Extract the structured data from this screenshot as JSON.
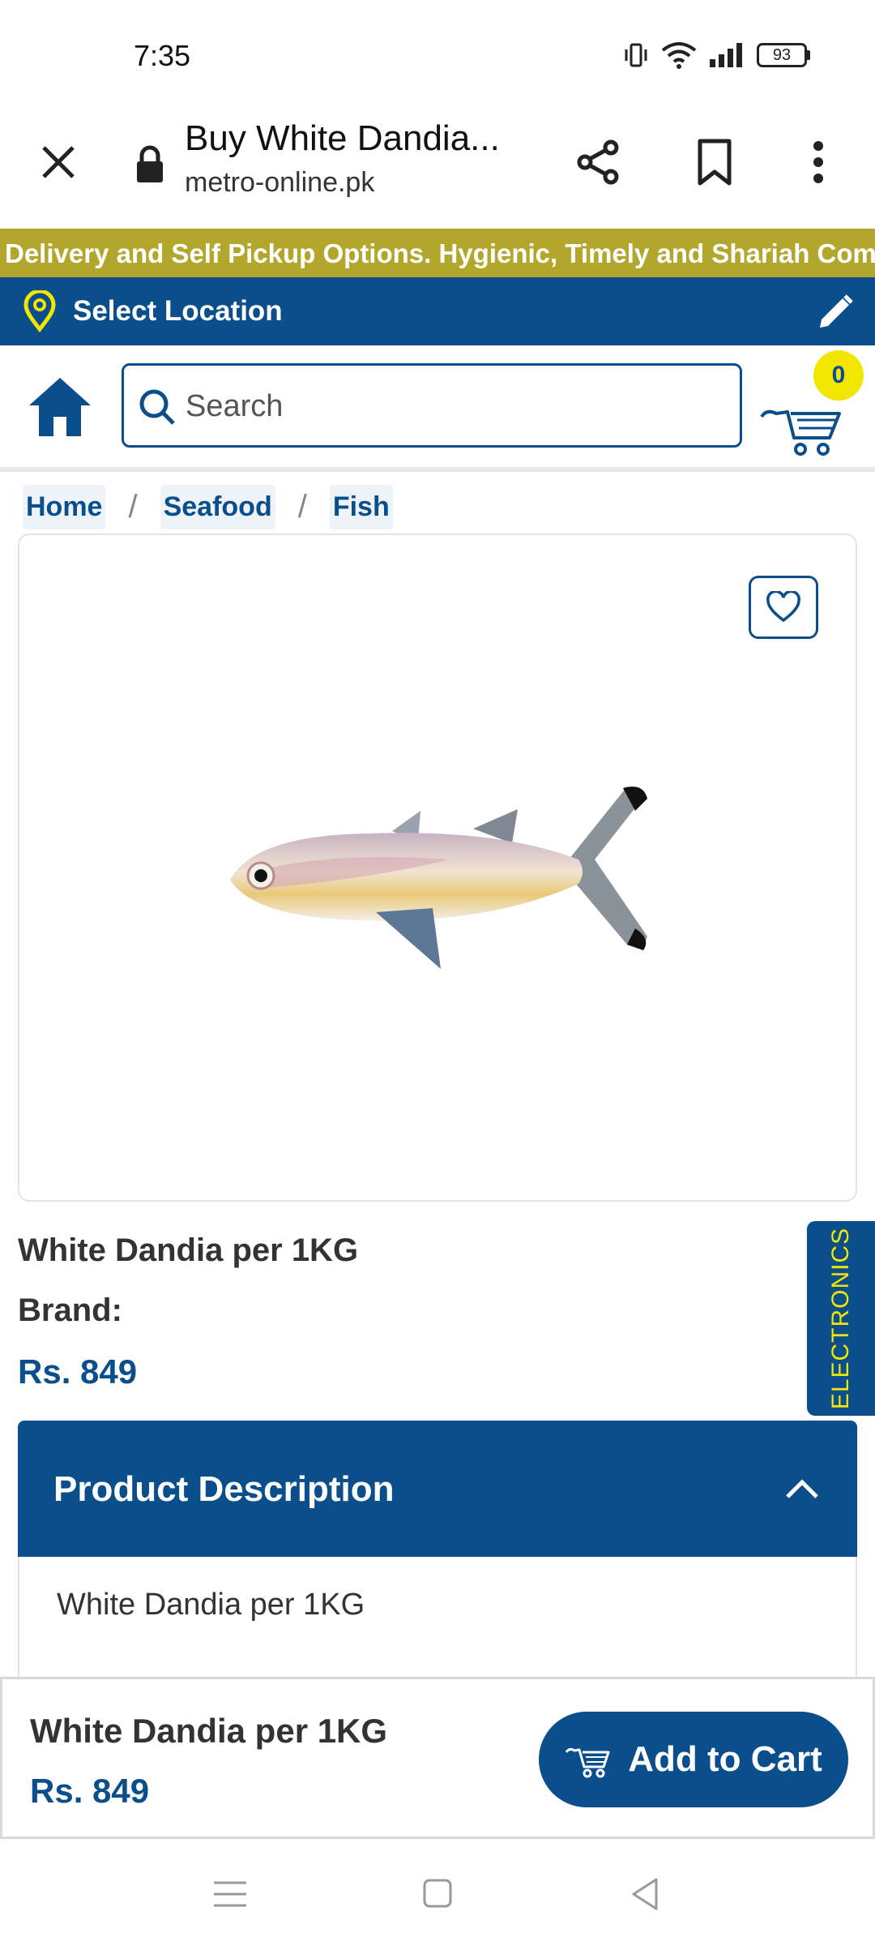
{
  "status_bar": {
    "time": "7:35",
    "battery": "93"
  },
  "browser": {
    "page_title": "Buy White Dandia...",
    "url": "metro-online.pk"
  },
  "ticker": {
    "text": "Delivery and Self Pickup Options. Hygienic, Timely and Shariah Compli"
  },
  "location": {
    "label": "Select Location"
  },
  "search": {
    "placeholder": "Search"
  },
  "cart": {
    "count": "0"
  },
  "breadcrumb": {
    "items": [
      "Home",
      "Seafood",
      "Fish"
    ],
    "separator": "/"
  },
  "product": {
    "name": "White Dandia per 1KG",
    "brand_label": "Brand:",
    "price": "Rs. 849"
  },
  "side_tab": {
    "label": "ELECTRONICS"
  },
  "description": {
    "heading": "Product Description",
    "body": "White Dandia per 1KG"
  },
  "sticky_footer": {
    "name": "White Dandia per 1KG",
    "price": "Rs. 849",
    "add_to_cart_label": "Add to Cart"
  },
  "colors": {
    "brand_blue": "#0b4e8c",
    "ticker_olive": "#b2a72c",
    "badge_yellow": "#f2e600"
  },
  "icons": [
    "close-icon",
    "lock-icon",
    "share-icon",
    "bookmark-icon",
    "more-vert-icon",
    "location-pin-icon",
    "edit-pencil-icon",
    "home-icon",
    "search-icon",
    "cart-icon",
    "heart-icon",
    "chevron-up-icon",
    "menu-icon",
    "square-icon",
    "back-triangle-icon"
  ]
}
